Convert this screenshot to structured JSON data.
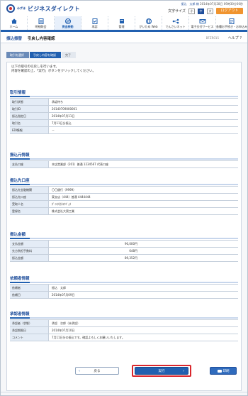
{
  "header": {
    "logo_small": "みずほ",
    "logo_text": "ビジネスダイレクト",
    "user_name": "振込　太郎 様",
    "user_rest": "2014年07月28日 09時30分00秒",
    "fontsize_label": "文字サイズ",
    "fontsize_options": [
      "小",
      "中",
      "大"
    ],
    "logout_label": "ログアウト"
  },
  "nav": [
    {
      "label": "ホーム",
      "icon": "home-icon"
    },
    {
      "label": "明細照会",
      "icon": "document-icon"
    },
    {
      "label": "資金移動",
      "icon": "transfer-icon"
    },
    {
      "label": "承認",
      "icon": "approve-icon"
    },
    {
      "label": "管理",
      "icon": "settings-icon"
    },
    {
      "label": "がいため Web",
      "icon": "globe-icon"
    },
    {
      "label": "でんさいネット",
      "icon": "network-icon"
    },
    {
      "label": "電子交付サービス",
      "icon": "mail-icon"
    },
    {
      "label": "各種お手続き・お申込み",
      "icon": "form-icon"
    }
  ],
  "titlebar": {
    "category": "振込振替",
    "title": "引戻し内容確認",
    "screen_id": "BFZR015",
    "help": "ヘルプ ?"
  },
  "steps": [
    "取引を選択",
    "引戻し内容を確認",
    "完了"
  ],
  "intro": {
    "line1": "以下の取引の引戻しを行います。",
    "line2": "内容を確認の上、「実行」ボタンをクリックしてください。"
  },
  "sections": {
    "transaction": {
      "title": "取引情報",
      "rows": [
        {
          "label": "取引状態",
          "value": "承認待ち"
        },
        {
          "label": "取引ID",
          "value": "20140709000001"
        },
        {
          "label": "振込指定日",
          "value": "2014年07月11日"
        },
        {
          "label": "取引名",
          "value": "7月11日分振込"
        },
        {
          "label": "EDI情報",
          "value": "－"
        }
      ]
    },
    "source": {
      "title": "振込元情報",
      "rows": [
        {
          "label": "支払口座",
          "value": "本店営業部（201）普通 1234567 代表口座"
        }
      ]
    },
    "destination": {
      "title": "振込先口座",
      "rows": [
        {
          "label": "振込先金融機関",
          "value": "〇〇銀行（9999）"
        },
        {
          "label": "振込先口座",
          "value": "東支店（444）普通 4444444"
        },
        {
          "label": "受取人名",
          "value": "ﾀﾞｲｺｸ(ｶ)ｺｳｷﾞｮｳ"
        },
        {
          "label": "登録名",
          "value": "株式会社大黒工業"
        }
      ]
    },
    "amount": {
      "title": "振込金額",
      "rows": [
        {
          "label": "支払金額",
          "value": "90,000円"
        },
        {
          "label": "先方負担手数料",
          "value": "648円"
        },
        {
          "label": "振込金額",
          "value": "89,352円"
        }
      ]
    },
    "requester": {
      "title": "依頼者情報",
      "rows": [
        {
          "label": "依頼者",
          "value": "振込　太郎"
        },
        {
          "label": "依頼日",
          "value": "2014年07月09日"
        }
      ]
    },
    "approver": {
      "title": "承認者情報",
      "rows": [
        {
          "label": "承認者（状態）",
          "value": "承認　次郎（未承認）"
        },
        {
          "label": "承認期限日",
          "value": "2014年07月10日"
        },
        {
          "label": "コメント",
          "value": "7月11日分の振込です。確認よろしくお願いいたします。"
        }
      ]
    }
  },
  "buttons": {
    "back": "戻る",
    "execute": "実行",
    "print": "印刷"
  },
  "colors": {
    "brand": "#1f4e9b",
    "accent": "#2160b0",
    "logout": "#f0942f",
    "highlight": "#d9262c"
  }
}
